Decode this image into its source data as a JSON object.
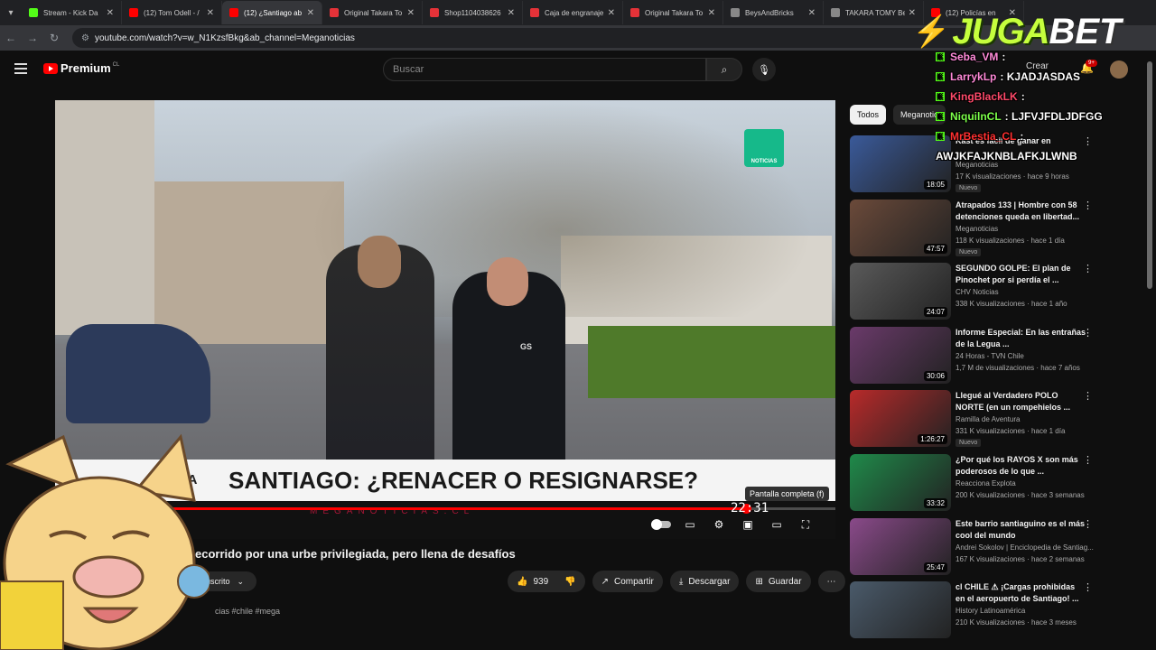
{
  "browser": {
    "tabs": [
      {
        "label": "Stream - Kick Da",
        "color": "#53fc18",
        "active": false
      },
      {
        "label": "(12) Tom Odell - /",
        "color": "#ff0000",
        "active": false
      },
      {
        "label": "(12) ¿Santiago ab",
        "color": "#ff0000",
        "active": true
      },
      {
        "label": "Original Takara To",
        "color": "#e53238",
        "active": false
      },
      {
        "label": "Shop1104038626",
        "color": "#e53238",
        "active": false
      },
      {
        "label": "Caja de engranaje",
        "color": "#e53238",
        "active": false
      },
      {
        "label": "Original Takara To",
        "color": "#e53238",
        "active": false
      },
      {
        "label": "BeysAndBricks",
        "color": "#888888",
        "active": false
      },
      {
        "label": "TAKARA TOMY Be",
        "color": "#888888",
        "active": false
      },
      {
        "label": "(12) Policías en ",
        "color": "#ff0000",
        "active": false
      }
    ],
    "url": "youtube.com/watch?v=w_N1KzsfBkg&ab_channel=Meganoticias"
  },
  "yt": {
    "logo_text": "Premium",
    "logo_region": "CL",
    "search_placeholder": "Buscar",
    "create_label": "Crear",
    "notif_count": "9+"
  },
  "video": {
    "badge_text": "NOTICIAS",
    "lower_third_tag": "GA",
    "headline": "SANTIAGO: ¿RENACER O RESIGNARSE?",
    "ticker_url": "MEGANOTICIAS.CL",
    "timecode": "22:31",
    "tooltip": "Pantalla completa (f)",
    "progress": 0.885,
    "title": "ecorrido por una urbe privilegiada, pero llena de desafíos",
    "subscribed_label": "Suscrito",
    "likes": "939",
    "share_label": "Compartir",
    "download_label": "Descargar",
    "save_label": "Guardar",
    "description": "cias #chile #mega"
  },
  "sidebar": {
    "chips": [
      "Todos",
      "Meganotic"
    ],
    "items": [
      {
        "title": "Kast es fácil de ganar en",
        "channel": "Meganoticias",
        "meta": "17 K visualizaciones · hace 9 horas",
        "duration": "18:05",
        "new": "Nuevo",
        "thumb": "#3a5a9a"
      },
      {
        "title": "Atrapados 133 | Hombre con 58 detenciones queda en libertad...",
        "channel": "Meganoticias",
        "meta": "118 K visualizaciones · hace 1 día",
        "duration": "47:57",
        "new": "Nuevo",
        "thumb": "#6b4a3a"
      },
      {
        "title": "SEGUNDO GOLPE: El plan de Pinochet por si perdía el ...",
        "channel": "CHV Noticias",
        "meta": "338 K visualizaciones · hace 1 año",
        "duration": "24:07",
        "new": "",
        "thumb": "#5a5a5a"
      },
      {
        "title": "Informe Especial: En las entrañas de la Legua ...",
        "channel": "24 Horas - TVN Chile",
        "meta": "1,7 M de visualizaciones · hace 7 años",
        "duration": "30:06",
        "new": "",
        "thumb": "#6a3a6a"
      },
      {
        "title": "Llegué al Verdadero POLO NORTE (en un rompehielos ...",
        "channel": "Ramilla de Aventura",
        "meta": "331 K visualizaciones · hace 1 día",
        "duration": "1:26:27",
        "new": "Nuevo",
        "thumb": "#b82a2a"
      },
      {
        "title": "¿Por qué los RAYOS X son más poderosos de lo que ...",
        "channel": "Reacciona Explota",
        "meta": "200 K visualizaciones · hace 3 semanas",
        "duration": "33:32",
        "new": "",
        "thumb": "#1f8a4a"
      },
      {
        "title": "Este barrio santiaguino es el más cool del mundo",
        "channel": "Andrei Sokolov | Enciclopedia de Santiag...",
        "meta": "167 K visualizaciones · hace 2 semanas",
        "duration": "25:47",
        "new": "",
        "thumb": "#8a4a8a"
      },
      {
        "title": "cl CHILE ⚠ ¡Cargas prohibidas en el aeropuerto de Santiago! ...",
        "channel": "History Latinoamérica",
        "meta": "210 K visualizaciones · hace 3 meses",
        "duration": "",
        "new": "",
        "thumb": "#4a5a6a"
      }
    ]
  },
  "overlay": {
    "brand_a": "JUGA",
    "brand_b": "BET",
    "chat": [
      {
        "name": "Seba_VM",
        "msg": ":",
        "color": "#ff8ad8"
      },
      {
        "name": "LarrykLp",
        "msg": ": KJADJASDAS",
        "color": "#ff8ad8"
      },
      {
        "name": "KingBlackLK",
        "msg": ":",
        "color": "#ff4a6a"
      },
      {
        "name": "NiquilnCL",
        "msg": ": LJFVJFDLJDFGG",
        "color": "#7cff4a"
      },
      {
        "name": "MrBestia_CL",
        "msg": ":",
        "color": "#ff3030"
      },
      {
        "name": "",
        "msg": "AWJKFAJKNBLAFKJLWNB",
        "color": "#ffffff"
      }
    ]
  }
}
